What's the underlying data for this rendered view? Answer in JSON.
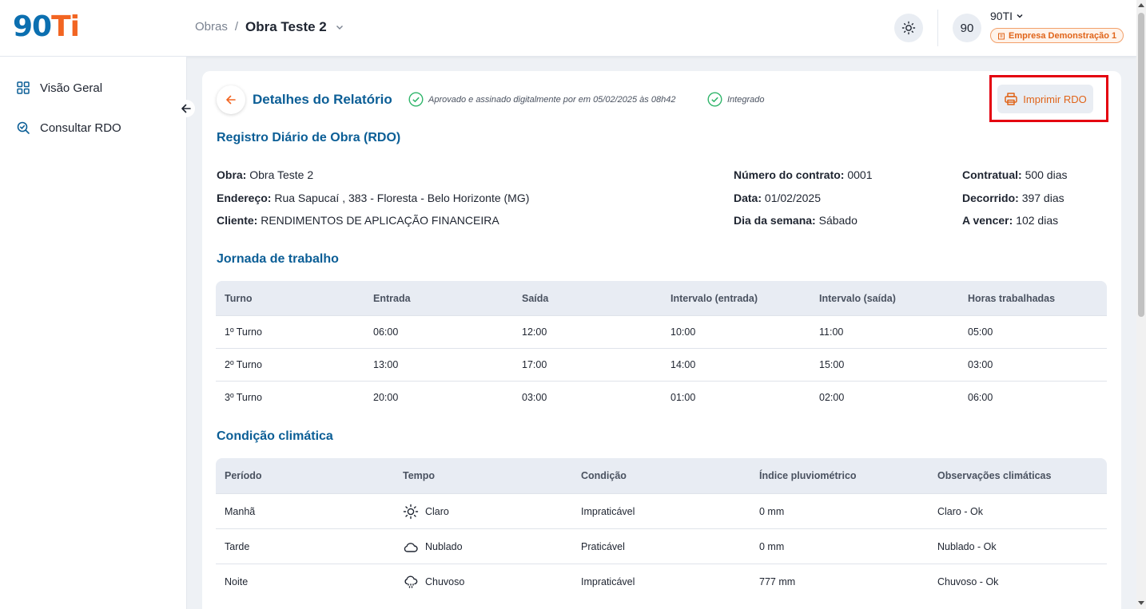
{
  "brand": {
    "logo_part1": "90",
    "logo_part2": "Ti"
  },
  "breadcrumb": {
    "parent": "Obras",
    "separator": "/",
    "current": "Obra Teste 2"
  },
  "user": {
    "avatar_text": "90",
    "name": "90TI",
    "company": "Empresa Demonstração 1"
  },
  "sidebar": {
    "items": [
      {
        "label": "Visão Geral",
        "icon": "grid-icon"
      },
      {
        "label": "Consultar RDO",
        "icon": "search-doc-icon"
      }
    ]
  },
  "report": {
    "title": "Detalhes do Relatório",
    "status_approved": "Aprovado e assinado digitalmente por em 05/02/2025 às 08h42",
    "status_integrated": "Integrado",
    "print_label": "Imprimir RDO",
    "rdo_title": "Registro Diário de Obra (RDO)",
    "info_left": [
      {
        "label": "Obra:",
        "value": "Obra Teste 2"
      },
      {
        "label": "Endereço:",
        "value": "Rua Sapucaí , 383 - Floresta - Belo Horizonte (MG)"
      },
      {
        "label": "Cliente:",
        "value": "RENDIMENTOS DE APLICAÇÃO FINANCEIRA"
      }
    ],
    "info_mid": [
      {
        "label": "Número do contrato:",
        "value": "0001"
      },
      {
        "label": "Data:",
        "value": "01/02/2025"
      },
      {
        "label": "Dia da semana:",
        "value": "Sábado"
      }
    ],
    "info_right": [
      {
        "label": "Contratual:",
        "value": "500 dias"
      },
      {
        "label": "Decorrido:",
        "value": "397 dias"
      },
      {
        "label": "A vencer:",
        "value": "102 dias"
      }
    ]
  },
  "jornada": {
    "title": "Jornada de trabalho",
    "headers": [
      "Turno",
      "Entrada",
      "Saída",
      "Intervalo (entrada)",
      "Intervalo (saída)",
      "Horas trabalhadas"
    ],
    "rows": [
      [
        "1º Turno",
        "06:00",
        "12:00",
        "10:00",
        "11:00",
        "05:00"
      ],
      [
        "2º Turno",
        "13:00",
        "17:00",
        "14:00",
        "15:00",
        "03:00"
      ],
      [
        "3º Turno",
        "20:00",
        "03:00",
        "01:00",
        "02:00",
        "06:00"
      ]
    ]
  },
  "clima": {
    "title": "Condição climática",
    "headers": [
      "Período",
      "Tempo",
      "Condição",
      "Índice pluviométrico",
      "Observações climáticas"
    ],
    "rows": [
      {
        "periodo": "Manhã",
        "tempo": "Claro",
        "icon": "sun-icon",
        "condicao": "Impraticável",
        "indice": "0 mm",
        "obs": "Claro - Ok"
      },
      {
        "periodo": "Tarde",
        "tempo": "Nublado",
        "icon": "cloud-icon",
        "condicao": "Praticável",
        "indice": "0 mm",
        "obs": "Nublado - Ok"
      },
      {
        "periodo": "Noite",
        "tempo": "Chuvoso",
        "icon": "rain-icon",
        "condicao": "Impraticável",
        "indice": "777 mm",
        "obs": "Chuvoso - Ok"
      }
    ]
  },
  "colors": {
    "brand_blue": "#0b6fb0",
    "brand_orange": "#f26522",
    "title_blue": "#0b5e96",
    "success_green": "#2fb56a",
    "highlight_red": "#e4000f"
  }
}
